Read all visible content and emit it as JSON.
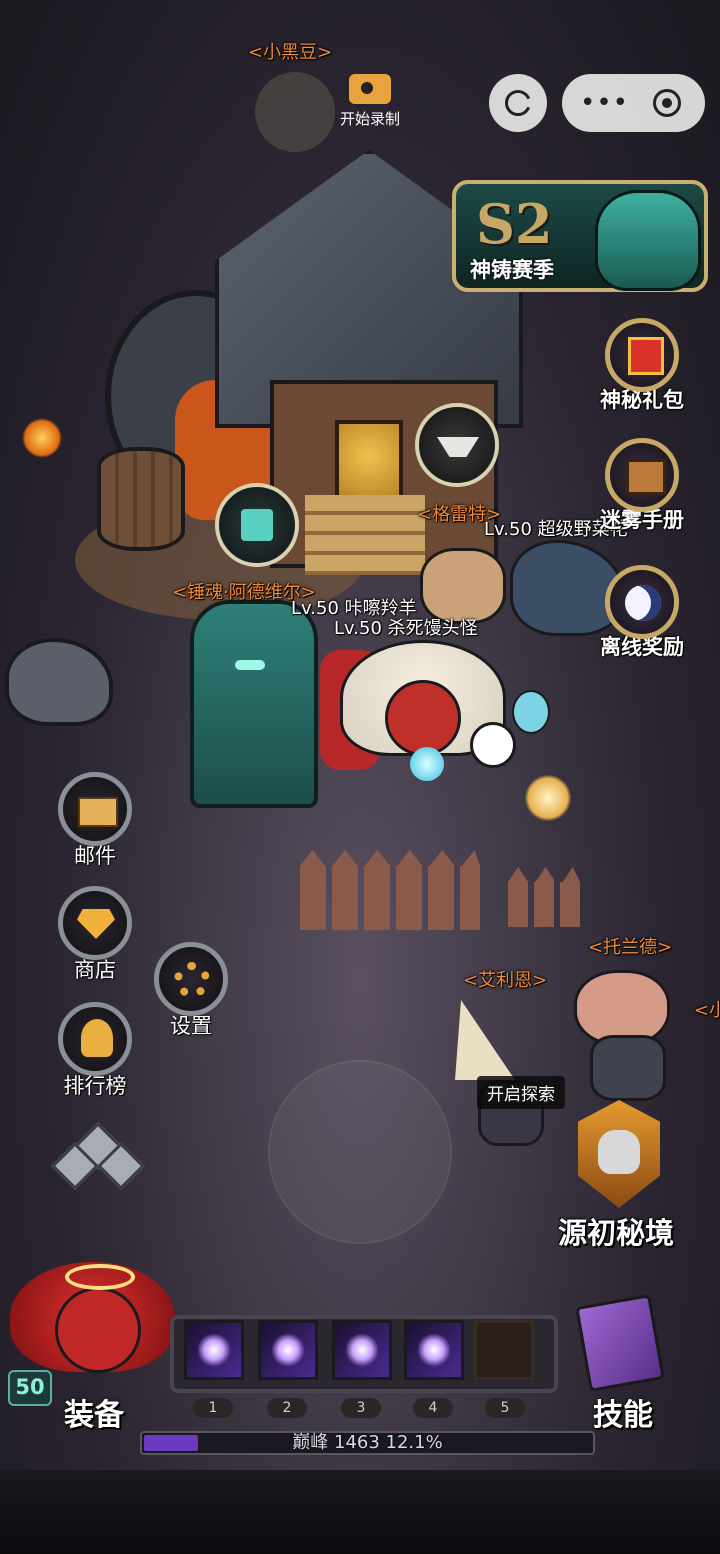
{
  "record": {
    "label": "开始录制"
  },
  "season": {
    "badge": "S2",
    "label": "神铸赛季"
  },
  "side_buttons": [
    {
      "label": "神秘礼包",
      "icon": "gift-icon"
    },
    {
      "label": "迷雾手册",
      "icon": "book-icon"
    },
    {
      "label": "离线奖励",
      "icon": "moon-icon"
    }
  ],
  "npcs": {
    "top": "<小黑豆>",
    "anvil": "<格雷特>",
    "hammer": "<锤魂·阿德维尔>",
    "wizard": "<艾利恩>",
    "pig": "<托兰德>",
    "pig_edge": "<小"
  },
  "players": [
    "Lv.50 超级野菜花",
    "Lv.50 咔嚓羚羊",
    "Lv.50 杀死馒头怪"
  ],
  "left_menu": [
    {
      "label": "邮件",
      "icon": "mail-icon"
    },
    {
      "label": "商店",
      "icon": "gem-icon"
    },
    {
      "label": "设置",
      "icon": "gear-icon"
    },
    {
      "label": "排行榜",
      "icon": "helmet-icon"
    }
  ],
  "explore": {
    "label": "开启探索"
  },
  "secret_realm": {
    "label": "源初秘境"
  },
  "player": {
    "level": "50",
    "equip_label": "装备"
  },
  "skills": {
    "label": "技能",
    "slots": [
      "1",
      "2",
      "3",
      "4",
      "5"
    ]
  },
  "rank": {
    "text": "巅峰 1463   12.1%",
    "progress": 0.121
  },
  "colors": {
    "name_orange": "#f08a3a",
    "gold_border": "#c7a865",
    "progress_fill": "#6a3ac0"
  }
}
